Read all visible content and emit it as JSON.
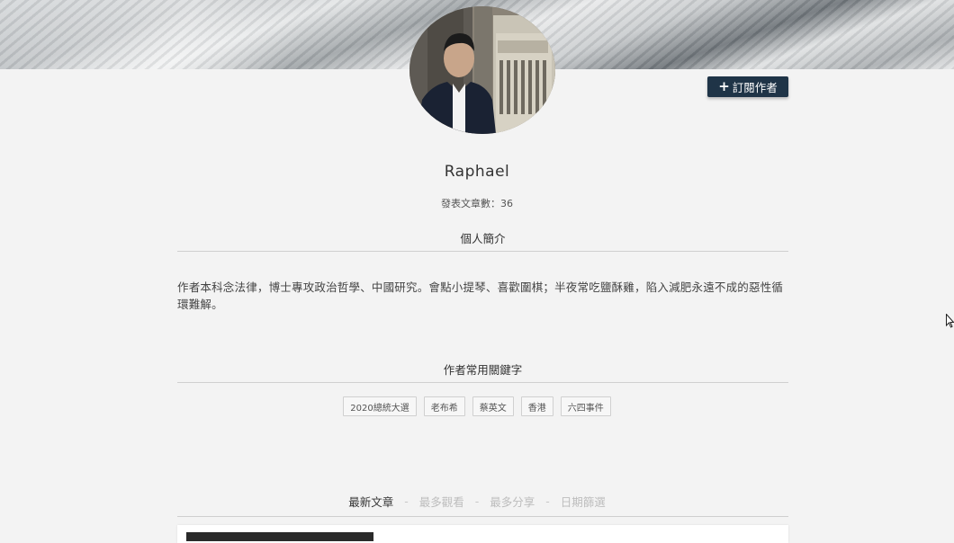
{
  "profile": {
    "name": "Raphael",
    "post_count": "發表文章數：36",
    "subscribe_label": "訂閱作者",
    "subscribe_icon": "plus-icon"
  },
  "bio": {
    "title": "個人簡介",
    "text": "作者本科念法律，博士專攻政治哲學、中國研究。會點小提琴、喜歡圍棋；半夜常吃鹽酥雞，陷入減肥永遠不成的惡性循環難解。"
  },
  "keywords": {
    "title": "作者常用關鍵字",
    "tags": [
      "2020總統大選",
      "老布希",
      "蔡英文",
      "香港",
      "六四事件"
    ]
  },
  "tabs": {
    "items": [
      "最新文章",
      "最多觀看",
      "最多分享",
      "日期篩選"
    ],
    "separator": "-",
    "active_index": 0
  },
  "colors": {
    "button_bg": "#1f3447",
    "page_bg": "#f3f3f3",
    "active_tab": "#333333",
    "inactive_tab": "#bdbdbd"
  }
}
